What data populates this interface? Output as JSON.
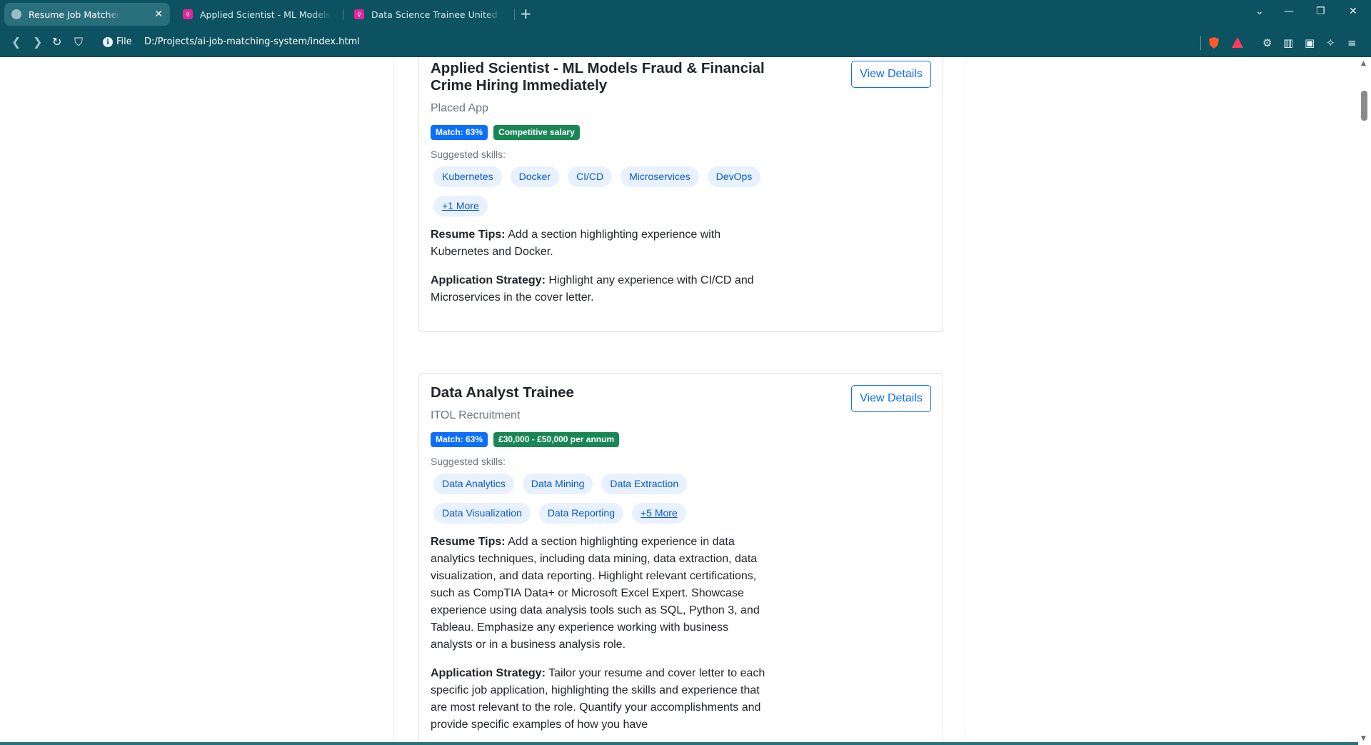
{
  "browser": {
    "tabs": [
      {
        "label": "Resume Job Matcher",
        "active": true,
        "icon": "globe-icon"
      },
      {
        "label": "Applied Scientist - ML Models Fraud & Financial Crime Hiring Immediately",
        "active": false,
        "icon": "placed-app-icon"
      },
      {
        "label": "Data Science Trainee United Kingdom",
        "active": false,
        "icon": "placed-app-icon"
      }
    ],
    "new_tab": "+",
    "scheme_label": "File",
    "url": "D:/Projects/ai-job-matching-system/index.html"
  },
  "jobs": [
    {
      "title": "Applied Scientist - ML Models Fraud & Financial Crime Hiring Immediately",
      "company": "Placed App",
      "view_label": "View Details",
      "match_badge": "Match: 63%",
      "salary_badge": "Competitive salary",
      "skills_label": "Suggested skills:",
      "skills": [
        "Kubernetes",
        "Docker",
        "CI/CD",
        "Microservices",
        "DevOps"
      ],
      "more_label": "+1 More",
      "tips_label": "Resume Tips:",
      "tips": "Add a section highlighting experience with Kubernetes and Docker.",
      "strategy_label": "Application Strategy:",
      "strategy": "Highlight any experience with CI/CD and Microservices in the cover letter."
    },
    {
      "title": "Data Analyst Trainee",
      "company": "ITOL Recruitment",
      "view_label": "View Details",
      "match_badge": "Match: 63%",
      "salary_badge": "£30,000 - £50,000 per annum",
      "skills_label": "Suggested skills:",
      "skills": [
        "Data Analytics",
        "Data Mining",
        "Data Extraction",
        "Data Visualization",
        "Data Reporting"
      ],
      "more_label": "+5 More",
      "tips_label": "Resume Tips:",
      "tips": "Add a section highlighting experience in data analytics techniques, including data mining, data extraction, data visualization, and data reporting. Highlight relevant certifications, such as CompTIA Data+ or Microsoft Excel Expert. Showcase experience using data analysis tools such as SQL, Python 3, and Tableau. Emphasize any experience working with business analysts or in a business analysis role.",
      "strategy_label": "Application Strategy:",
      "strategy": "Tailor your resume and cover letter to each specific job application, highlighting the skills and experience that are most relevant to the role. Quantify your accomplishments and provide specific examples of how you have"
    }
  ],
  "colors": {
    "chrome": "#0d5260",
    "primary": "#0d6efd",
    "success": "#198754",
    "skill_bg": "#e7f1ff"
  }
}
